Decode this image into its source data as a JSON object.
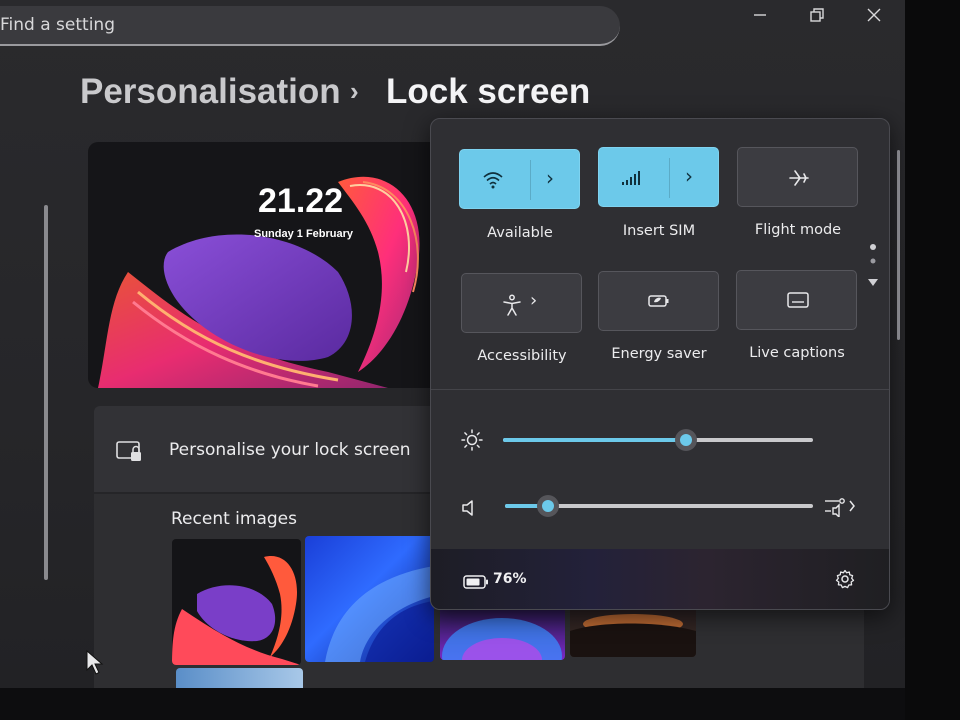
{
  "search": {
    "placeholder": "Find a setting"
  },
  "breadcrumb": {
    "parent": "Personalisation",
    "separator": "›",
    "current": "Lock screen"
  },
  "preview": {
    "time": "21.22",
    "date": "Sunday 1 February"
  },
  "lock_card": {
    "label": "Personalise your lock screen"
  },
  "recent": {
    "label": "Recent images"
  },
  "quick_settings": {
    "tiles": [
      {
        "label": "Available",
        "icon": "wifi-icon",
        "active": true,
        "has_chevron": true
      },
      {
        "label": "Insert SIM",
        "icon": "cellular-icon",
        "active": true,
        "has_chevron": true
      },
      {
        "label": "Flight mode",
        "icon": "airplane-icon",
        "active": false,
        "has_chevron": false
      },
      {
        "label": "Accessibility",
        "icon": "accessibility-icon",
        "active": false,
        "has_chevron": true
      },
      {
        "label": "Energy saver",
        "icon": "energy-saver-icon",
        "active": false,
        "has_chevron": false
      },
      {
        "label": "Live captions",
        "icon": "captions-icon",
        "active": false,
        "has_chevron": false
      }
    ],
    "brightness": {
      "icon": "brightness-icon",
      "level": 0.59
    },
    "volume": {
      "icon": "speaker-icon",
      "level": 0.14
    },
    "battery": {
      "icon": "battery-icon",
      "percent": "76%"
    },
    "settings_icon": "gear-icon"
  },
  "colors": {
    "accent": "#6cc9ea",
    "tile_off": "#3c3c41",
    "flyout_bg": "#2f2f33"
  }
}
